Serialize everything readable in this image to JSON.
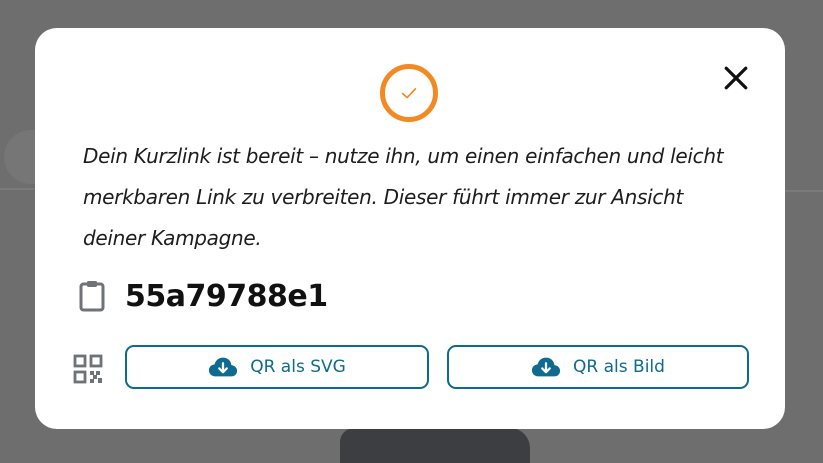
{
  "modal": {
    "message": "Dein Kurzlink ist bereit – nutze ihn, um einen einfachen und leicht merkbaren Link zu verbreiten. Dieser führt immer zur Ansicht deiner Kampagne.",
    "short_link": "55a79788e1",
    "buttons": {
      "qr_svg_label": "QR als SVG",
      "qr_image_label": "QR als Bild"
    }
  },
  "icons": {
    "status": "check-circle-icon",
    "close": "close-icon",
    "clipboard": "clipboard-icon",
    "qr": "qr-code-icon",
    "download": "cloud-download-icon"
  },
  "colors": {
    "accent_orange": "#f28a24",
    "button_blue": "#0e6a8f",
    "backdrop": "#6e6e6e",
    "text": "#1d1d1d"
  }
}
